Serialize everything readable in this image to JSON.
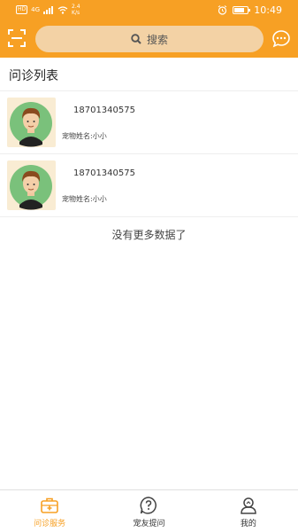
{
  "status_bar": {
    "network": "HD",
    "signal": "4G",
    "speed_value": "2.4",
    "speed_unit": "K/s",
    "time": "10:49",
    "battery_level": 0.75
  },
  "header": {
    "search_placeholder": "搜索"
  },
  "page_title": "问诊列表",
  "consultations": [
    {
      "phone": "18701340575",
      "pet_label": "宠物姓名:",
      "pet_name": "小小"
    },
    {
      "phone": "18701340575",
      "pet_label": "宠物姓名:",
      "pet_name": "小小"
    }
  ],
  "no_more_text": "没有更多数据了",
  "tabs": [
    {
      "label": "问诊服务",
      "icon": "medical-kit-icon",
      "active": true
    },
    {
      "label": "宠友提问",
      "icon": "question-icon",
      "active": false
    },
    {
      "label": "我的",
      "icon": "user-icon",
      "active": false
    }
  ],
  "colors": {
    "accent": "#f7a024",
    "search_bg": "#f3d2a5"
  }
}
